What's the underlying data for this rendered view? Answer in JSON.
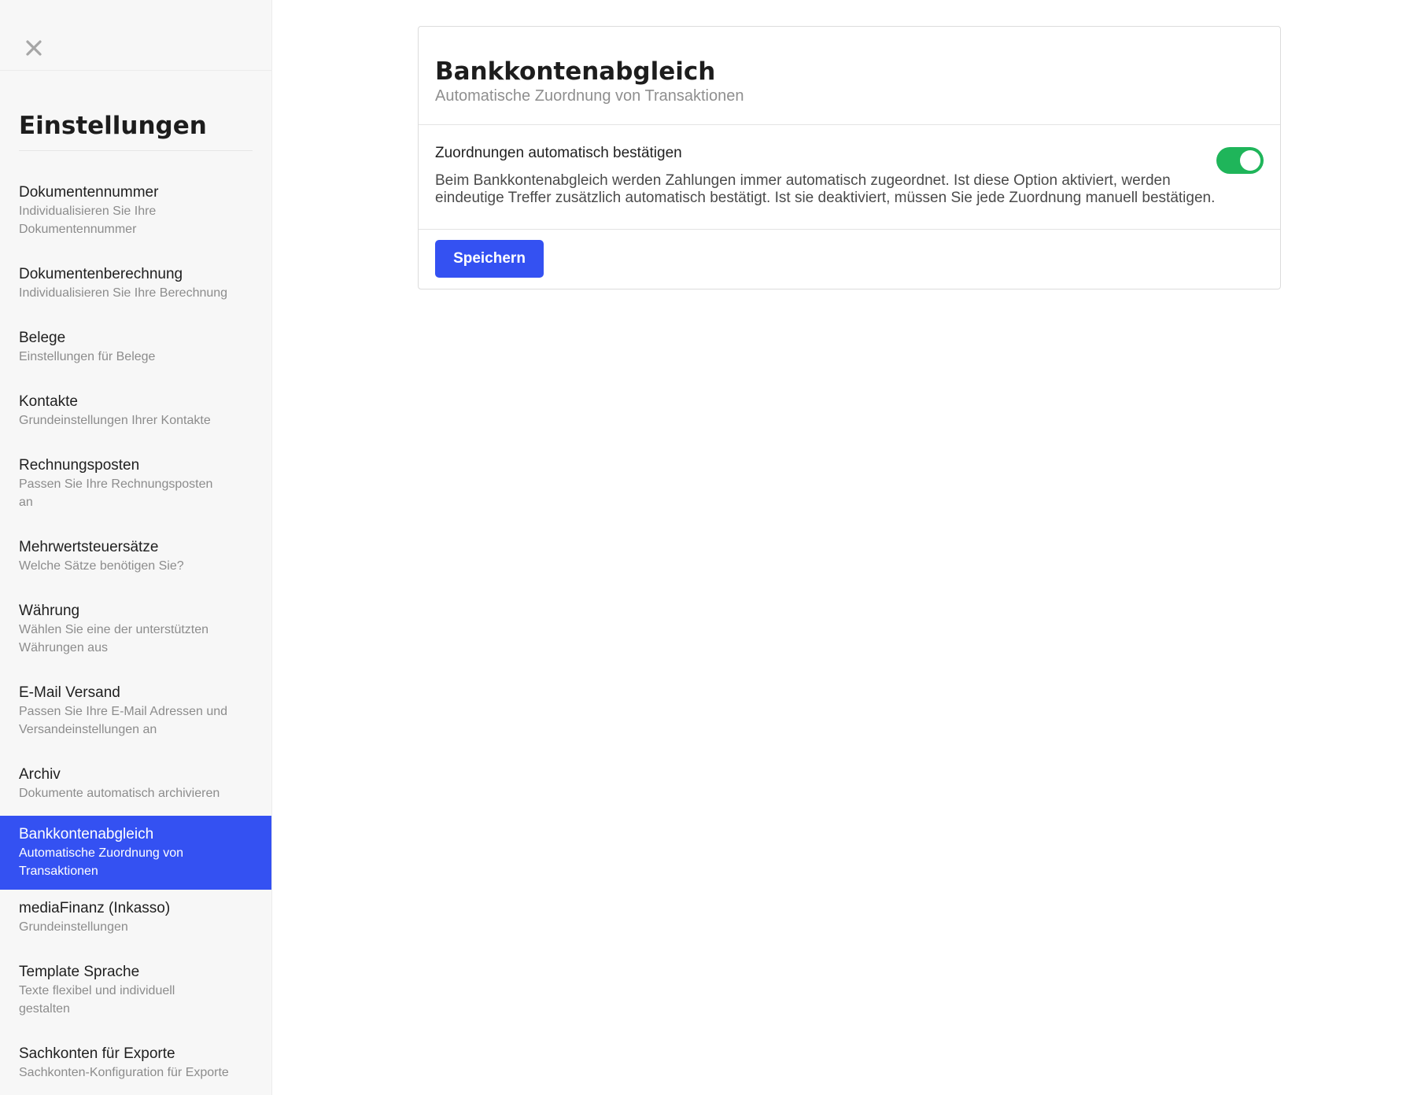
{
  "sidebar": {
    "title": "Einstellungen",
    "items": [
      {
        "label": "Dokumentennummer",
        "desc": "Individualisieren Sie Ihre Dokumentennummer",
        "active": false
      },
      {
        "label": "Dokumentenberechnung",
        "desc": "Individualisieren Sie Ihre Berechnung",
        "active": false
      },
      {
        "label": "Belege",
        "desc": "Einstellungen für Belege",
        "active": false
      },
      {
        "label": "Kontakte",
        "desc": "Grundeinstellungen Ihrer Kontakte",
        "active": false
      },
      {
        "label": "Rechnungsposten",
        "desc": "Passen Sie Ihre Rechnungsposten an",
        "active": false
      },
      {
        "label": "Mehrwertsteuersätze",
        "desc": "Welche Sätze benötigen Sie?",
        "active": false
      },
      {
        "label": "Währung",
        "desc": "Wählen Sie eine der unterstützten Währungen aus",
        "active": false
      },
      {
        "label": "E-Mail Versand",
        "desc": "Passen Sie Ihre E-Mail Adressen und Versandeinstellungen an",
        "active": false
      },
      {
        "label": "Archiv",
        "desc": "Dokumente automatisch archivieren",
        "active": false
      },
      {
        "label": "Bankkontenabgleich",
        "desc": "Automatische Zuordnung von Transaktionen",
        "active": true
      },
      {
        "label": "mediaFinanz (Inkasso)",
        "desc": "Grundeinstellungen",
        "active": false
      },
      {
        "label": "Template Sprache",
        "desc": "Texte flexibel und individuell gestalten",
        "active": false
      },
      {
        "label": "Sachkonten für Exporte",
        "desc": "Sachkonten-Konfiguration für Exporte",
        "active": false
      }
    ]
  },
  "main": {
    "title": "Bankkontenabgleich",
    "subtitle": "Automatische Zuordnung von Transaktionen",
    "setting": {
      "label": "Zuordnungen automatisch bestätigen",
      "description": "Beim Bankkontenabgleich werden Zahlungen immer automatisch zugeordnet. Ist diese Option aktiviert, werden eindeutige Treffer zusätzlich automatisch bestätigt. Ist sie deaktiviert, müssen Sie jede Zuordnung manuell bestätigen.",
      "enabled": true
    },
    "save_label": "Speichern"
  },
  "icons": {
    "close": "close-icon"
  },
  "colors": {
    "accent": "#3451f2",
    "toggle_on": "#1fb55a",
    "sidebar_bg": "#f7f7f7"
  }
}
